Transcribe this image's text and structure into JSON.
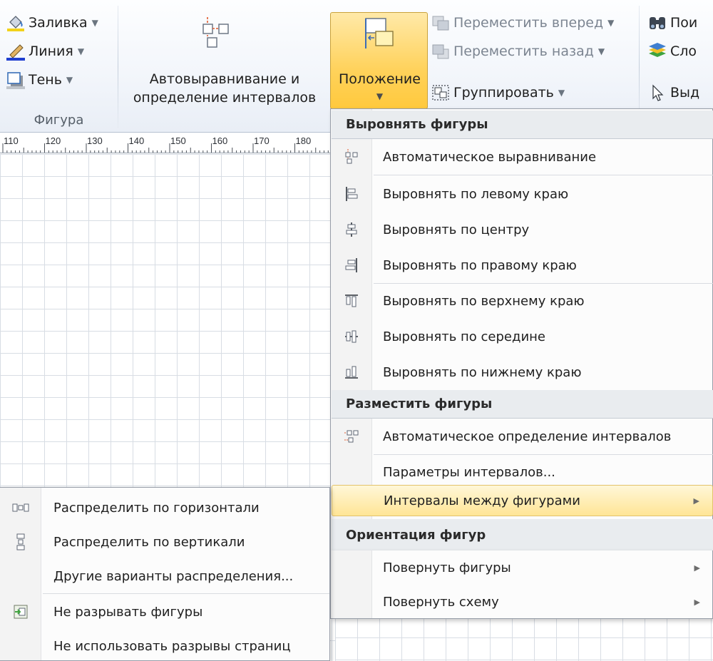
{
  "ribbon": {
    "shape_group": {
      "fill": "Заливка",
      "line": "Линия",
      "shadow": "Тень",
      "group_label": "Фигура"
    },
    "auto_align": {
      "line1": "Автовыравнивание и",
      "line2": "определение интервалов"
    },
    "position": {
      "label": "Положение"
    },
    "arrange": {
      "bring_forward": "Переместить вперед",
      "send_backward": "Переместить назад",
      "group": "Группировать"
    },
    "editing": {
      "find": "Пои",
      "layers": "Сло",
      "select": "Выд"
    }
  },
  "ruler": {
    "ticks": [
      "110",
      "120",
      "130",
      "140",
      "150",
      "160",
      "170",
      "180"
    ]
  },
  "menu": {
    "header_align": "Выровнять фигуры",
    "auto_align": "Автоматическое выравнивание",
    "align_left": "Выровнять по левому краю",
    "align_center": "Выровнять по центру",
    "align_right": "Выровнять по правому краю",
    "align_top": "Выровнять по верхнему краю",
    "align_middle": "Выровнять по середине",
    "align_bottom": "Выровнять по нижнему краю",
    "header_space": "Разместить фигуры",
    "auto_space": "Автоматическое определение интервалов",
    "spacing_options": "Параметры интервалов...",
    "spacing_between": "Интервалы между фигурами",
    "header_orient": "Ориентация фигур",
    "rotate_shapes": "Повернуть фигуры",
    "rotate_diagram": "Повернуть схему"
  },
  "submenu": {
    "distribute_h": "Распределить по горизонтали",
    "distribute_v": "Распределить по вертикали",
    "other_distribute": "Другие варианты распределения...",
    "keep_together": "Не разрывать фигуры",
    "no_page_breaks": "Не использовать разрывы страниц"
  },
  "colors": {
    "highlight": "#ffe596",
    "fill_swatch": "#f2d21a",
    "line_swatch": "#1f3fd0"
  }
}
